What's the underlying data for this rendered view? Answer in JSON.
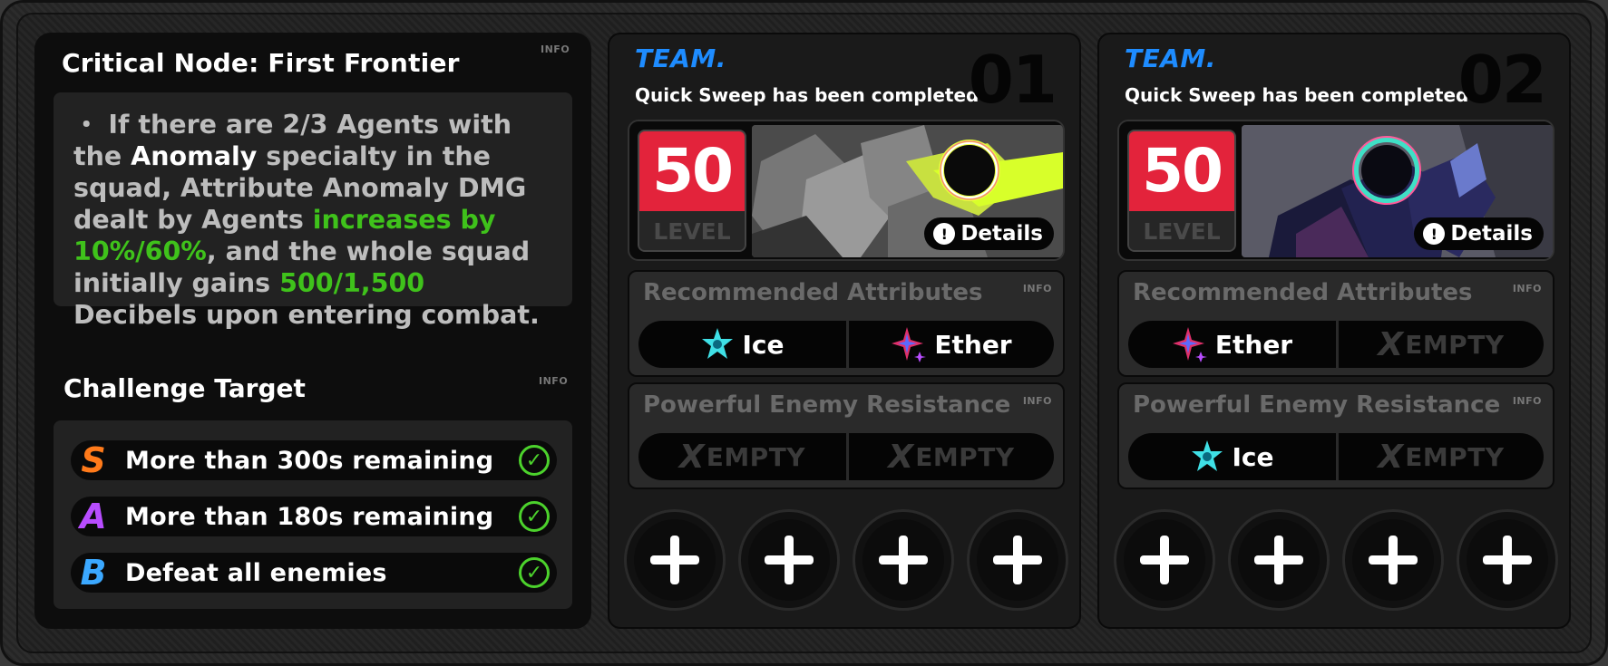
{
  "node": {
    "title": "Critical Node: First Frontier",
    "info": "INFO",
    "desc_1": "・ If there are 2/3 Agents with the ",
    "desc_anomaly": "Anomaly",
    "desc_2": " specialty in the squad, Attribute Anomaly DMG dealt by Agents ",
    "desc_green1": "increases by 10%/60%",
    "desc_3": ", and the whole squad initially gains ",
    "desc_green2": "500/1,500",
    "desc_4": " Decibels upon entering combat."
  },
  "challenge": {
    "title": "Challenge Target",
    "info": "INFO",
    "targets": [
      {
        "grade": "S",
        "text": "More than 300s remaining"
      },
      {
        "grade": "A",
        "text": "More than 180s remaining"
      },
      {
        "grade": "B",
        "text": "Defeat all enemies"
      }
    ]
  },
  "teams": [
    {
      "label": "TEAM.",
      "subtitle": "Quick Sweep has been completed",
      "number": "01",
      "level": "50",
      "level_label": "LEVEL",
      "details": "Details",
      "recommended_title": "Recommended Attributes",
      "recommended_info": "INFO",
      "recommended": [
        "Ice",
        "Ether"
      ],
      "resistance_title": "Powerful Enemy Resistance",
      "resistance_info": "INFO",
      "resistance": [
        "EMPTY",
        "EMPTY"
      ]
    },
    {
      "label": "TEAM.",
      "subtitle": "Quick Sweep has been completed",
      "number": "02",
      "level": "50",
      "level_label": "LEVEL",
      "details": "Details",
      "recommended_title": "Recommended Attributes",
      "recommended_info": "INFO",
      "recommended": [
        "Ether",
        "EMPTY"
      ],
      "resistance_title": "Powerful Enemy Resistance",
      "resistance_info": "INFO",
      "resistance": [
        "Ice",
        "EMPTY"
      ]
    }
  ],
  "colors": {
    "team_blue": "#1e8cff",
    "level_red": "#e3233b",
    "highlight_green": "#3fc21b",
    "grade_s": "#ff7a1a",
    "grade_a": "#b84dff",
    "grade_b": "#3ba8ff",
    "ice": "#3fe0e6",
    "ether": "#e0306a"
  },
  "icons": {
    "ice": "ice-attribute-icon",
    "ether": "ether-attribute-icon",
    "empty": "x-empty-mark",
    "check": "check-circle-icon",
    "add": "plus-icon",
    "details": "info-circle-icon"
  }
}
